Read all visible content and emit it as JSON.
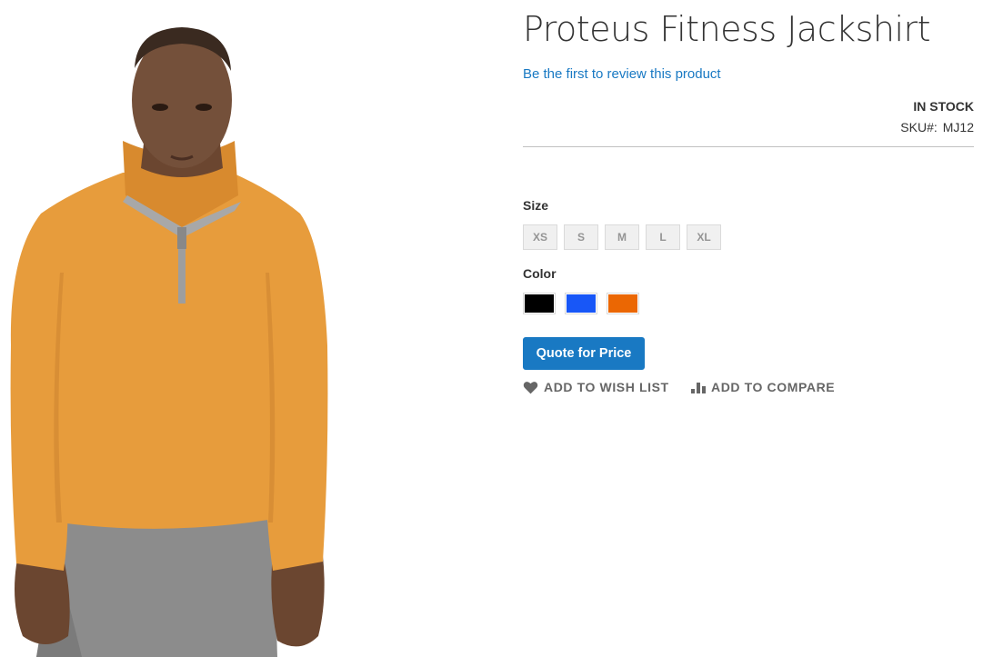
{
  "product": {
    "title": "Proteus Fitness Jackshirt",
    "review_link": "Be the first to review this product",
    "stock_status": "IN STOCK",
    "sku_label": "SKU#:",
    "sku_value": "MJ12",
    "image_alt": "product-photo-man-wearing-orange-jackshirt"
  },
  "options": {
    "size_label": "Size",
    "sizes": [
      "XS",
      "S",
      "M",
      "L",
      "XL"
    ],
    "color_label": "Color",
    "colors": [
      {
        "name": "Black",
        "hex": "#000000"
      },
      {
        "name": "Blue",
        "hex": "#1857f7"
      },
      {
        "name": "Orange",
        "hex": "#eb6703"
      }
    ]
  },
  "actions": {
    "quote_button": "Quote for Price",
    "wishlist": "ADD TO WISH LIST",
    "compare": "ADD TO COMPARE"
  },
  "colors": {
    "accent": "#1979c3",
    "shirt": "#e79c3c",
    "shorts": "#8c8c8c"
  }
}
